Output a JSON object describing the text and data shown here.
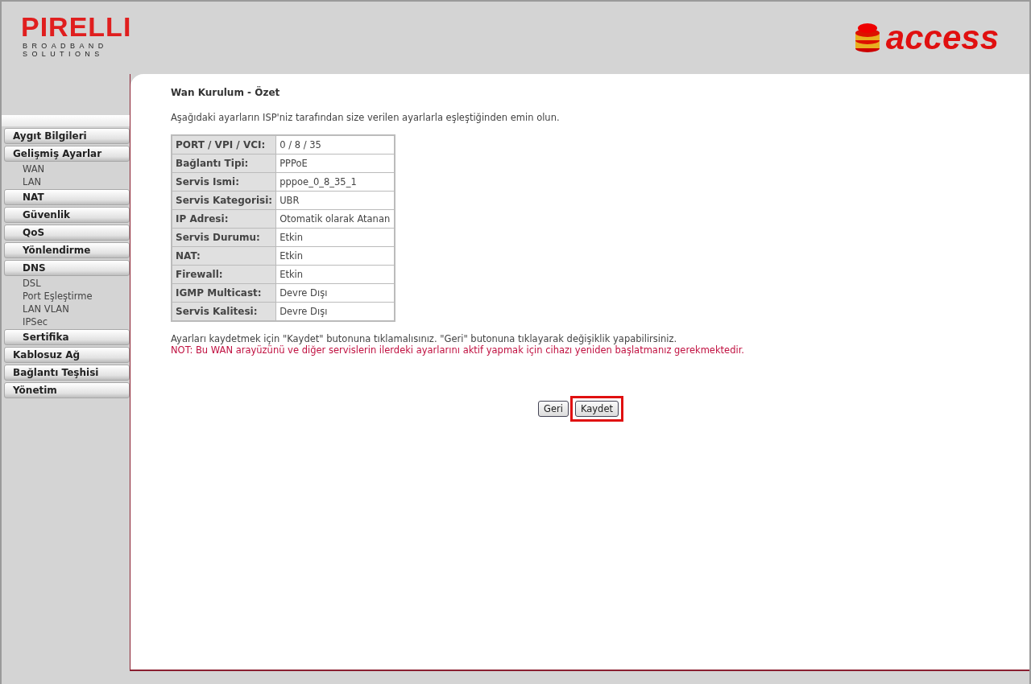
{
  "header": {
    "brand": "PIRELLI",
    "brand_sub": [
      "BROADBAND",
      "SOLUTIONS"
    ],
    "partner_logo": "access"
  },
  "sidebar": {
    "items": [
      {
        "label": "Aygıt Bilgileri",
        "kind": "main"
      },
      {
        "label": "Gelişmiş Ayarlar",
        "kind": "main",
        "children": [
          {
            "label": "WAN",
            "kind": "link"
          },
          {
            "label": "LAN",
            "kind": "link"
          },
          {
            "label": "NAT",
            "kind": "section"
          },
          {
            "label": "Güvenlik",
            "kind": "section"
          },
          {
            "label": "QoS",
            "kind": "section"
          },
          {
            "label": "Yönlendirme",
            "kind": "section"
          },
          {
            "label": "DNS",
            "kind": "section"
          },
          {
            "label": "DSL",
            "kind": "link"
          },
          {
            "label": "Port Eşleştirme",
            "kind": "link"
          },
          {
            "label": "LAN VLAN",
            "kind": "link"
          },
          {
            "label": "IPSec",
            "kind": "link"
          },
          {
            "label": "Sertifika",
            "kind": "section"
          }
        ]
      },
      {
        "label": "Kablosuz Ağ",
        "kind": "main"
      },
      {
        "label": "Bağlantı Teşhisi",
        "kind": "main"
      },
      {
        "label": "Yönetim",
        "kind": "main"
      }
    ]
  },
  "page": {
    "title": "Wan Kurulum - Özet",
    "intro": "Aşağıdaki ayarların ISP'niz tarafından size verilen ayarlarla eşleştiğinden emin olun.",
    "summary_rows": [
      {
        "label": "PORT / VPI / VCI:",
        "value": "0 / 8 / 35"
      },
      {
        "label": "Bağlantı Tipi:",
        "value": "PPPoE"
      },
      {
        "label": "Servis Ismi:",
        "value": "pppoe_0_8_35_1"
      },
      {
        "label": "Servis Kategorisi:",
        "value": "UBR"
      },
      {
        "label": "IP Adresi:",
        "value": "Otomatik olarak Atanan"
      },
      {
        "label": "Servis Durumu:",
        "value": "Etkin"
      },
      {
        "label": "NAT:",
        "value": "Etkin"
      },
      {
        "label": "Firewall:",
        "value": "Etkin"
      },
      {
        "label": "IGMP Multicast:",
        "value": "Devre Dışı"
      },
      {
        "label": "Servis Kalitesi:",
        "value": "Devre Dışı"
      }
    ],
    "help": "Ayarları kaydetmek için \"Kaydet\" butonuna tıklamalısınız. \"Geri\" butonuna tıklayarak değişiklik yapabilirsiniz.",
    "note": "NOT: Bu WAN arayüzünü ve diğer servislerin ilerdeki ayarlarını aktif yapmak için cihazı yeniden başlatmanız gerekmektedir.",
    "buttons": [
      {
        "label": "Geri",
        "highlighted": false
      },
      {
        "label": "Kaydet",
        "highlighted": true
      }
    ]
  }
}
